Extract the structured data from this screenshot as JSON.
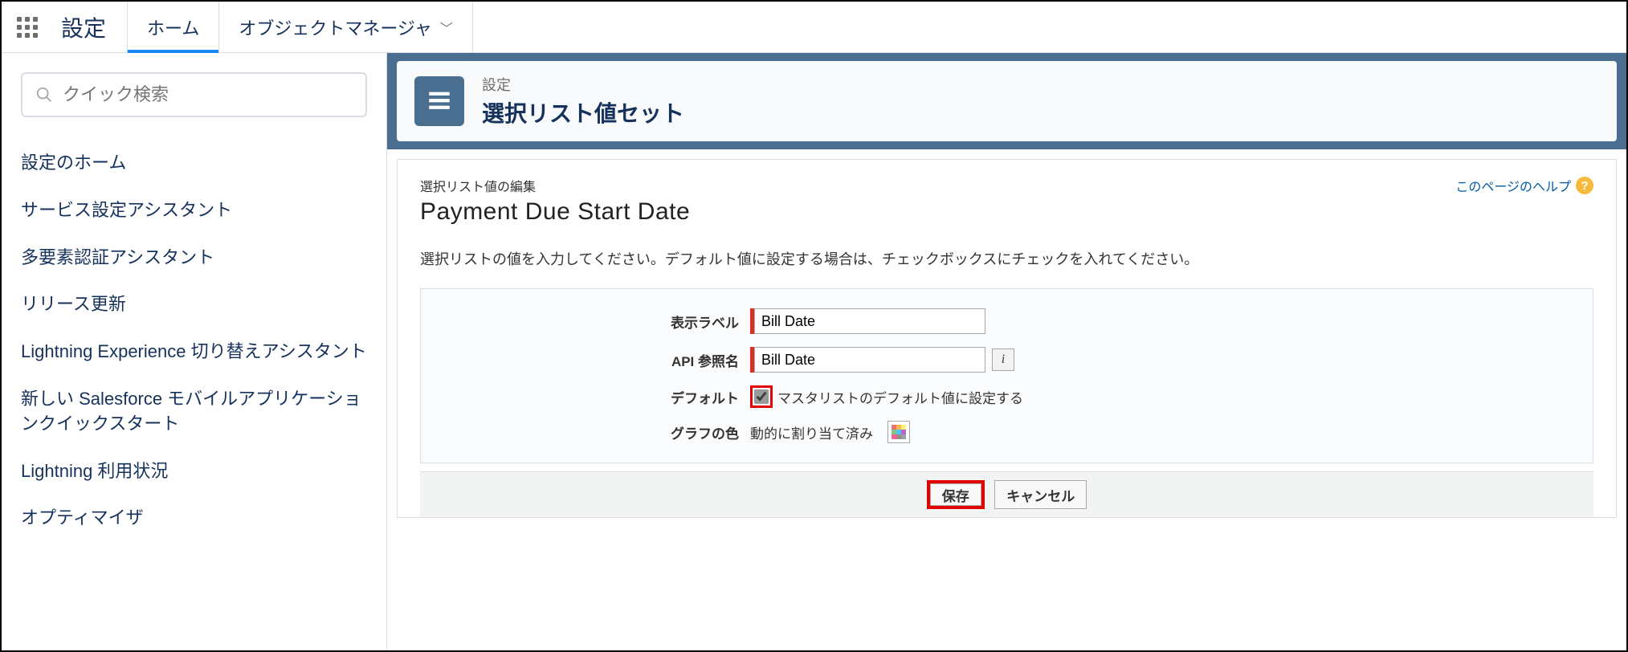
{
  "topbar": {
    "app_title": "設定",
    "tab_home": "ホーム",
    "tab_object_manager": "オブジェクトマネージャ"
  },
  "sidebar": {
    "search_placeholder": "クイック検索",
    "items": [
      "設定のホーム",
      "サービス設定アシスタント",
      "多要素認証アシスタント",
      "リリース更新",
      "Lightning Experience 切り替えアシスタント",
      "新しい Salesforce モバイルアプリケーションクイックスタート",
      "Lightning 利用状況",
      "オプティマイザ"
    ]
  },
  "banner": {
    "breadcrumb": "設定",
    "title": "選択リスト値セット"
  },
  "page": {
    "section_small": "選択リスト値の編集",
    "section_title": "Payment Due Start Date",
    "help_link": "このページのヘルプ",
    "description": "選択リストの値を入力してください。デフォルト値に設定する場合は、チェックボックスにチェックを入れてください。"
  },
  "form": {
    "label_display": "表示ラベル",
    "value_display": "Bill Date",
    "label_api": "API 参照名",
    "value_api": "Bill Date",
    "label_default": "デフォルト",
    "default_checkbox_text": "マスタリストのデフォルト値に設定する",
    "default_checked": true,
    "label_color": "グラフの色",
    "color_value": "動的に割り当て済み"
  },
  "buttons": {
    "save": "保存",
    "cancel": "キャンセル"
  }
}
